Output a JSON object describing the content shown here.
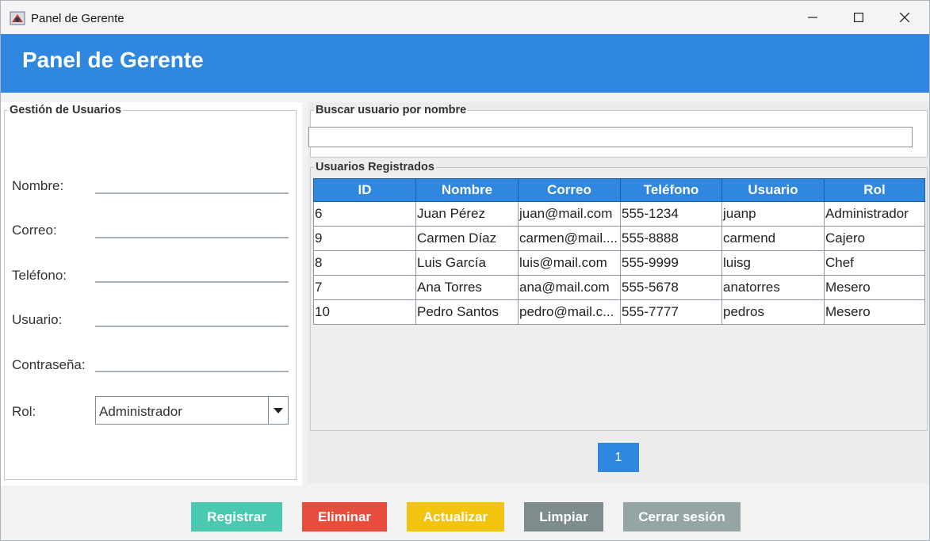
{
  "window": {
    "title": "Panel de Gerente"
  },
  "header": {
    "title": "Panel de Gerente"
  },
  "form": {
    "legend": "Gestión de Usuarios",
    "nombre_label": "Nombre:",
    "correo_label": "Correo:",
    "telefono_label": "Teléfono:",
    "usuario_label": "Usuario:",
    "contrasena_label": "Contraseña:",
    "rol_label": "Rol:",
    "rol_value": "Administrador"
  },
  "search": {
    "legend": "Buscar usuario por nombre",
    "value": ""
  },
  "table": {
    "legend": "Usuarios Registrados",
    "columns": [
      "ID",
      "Nombre",
      "Correo",
      "Teléfono",
      "Usuario",
      "Rol"
    ],
    "rows": [
      [
        "6",
        "Juan Pérez",
        "juan@mail.com",
        "555-1234",
        "juanp",
        "Administrador"
      ],
      [
        "9",
        "Carmen Díaz",
        "carmen@mail....",
        "555-8888",
        "carmend",
        "Cajero"
      ],
      [
        "8",
        "Luis García",
        "luis@mail.com",
        "555-9999",
        "luisg",
        "Chef"
      ],
      [
        "7",
        "Ana Torres",
        "ana@mail.com",
        "555-5678",
        "anatorres",
        "Mesero"
      ],
      [
        "10",
        "Pedro Santos",
        "pedro@mail.c...",
        "555-7777",
        "pedros",
        "Mesero"
      ]
    ]
  },
  "pagination": {
    "current_page": "1"
  },
  "actions": {
    "registrar": "Registrar",
    "eliminar": "Eliminar",
    "actualizar": "Actualizar",
    "limpiar": "Limpiar",
    "cerrar": "Cerrar sesión"
  },
  "colors": {
    "header": "#2f87df",
    "registrar": "#48c9b0",
    "eliminar": "#e74c3c",
    "actualizar": "#f1c40f",
    "limpiar": "#7f8c8d",
    "cerrar": "#95a5a6"
  },
  "icons": {
    "app": "java-app-icon",
    "minimize": "minimize-icon",
    "maximize": "maximize-icon",
    "close": "close-icon",
    "dropdown": "chevron-down-icon"
  }
}
